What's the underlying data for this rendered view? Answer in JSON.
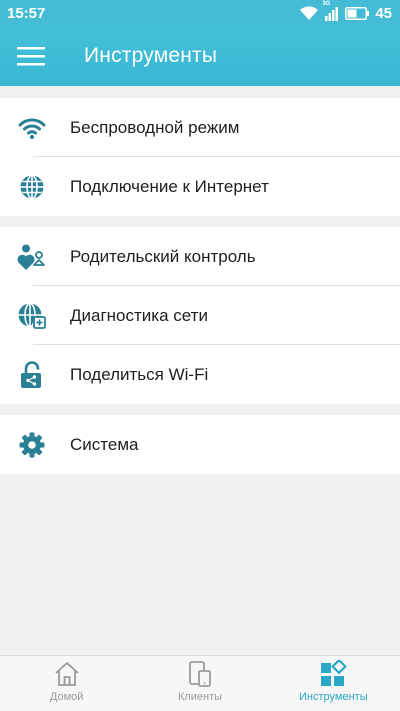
{
  "status_bar": {
    "time": "15:57",
    "network": "3G",
    "battery": "45",
    "icons": [
      "wifi-icon",
      "signal-icon",
      "battery-icon"
    ]
  },
  "app_bar": {
    "title": "Инструменты",
    "menu_icon": "hamburger-menu-icon"
  },
  "sections": [
    {
      "items": [
        {
          "label": "Беспроводной режим",
          "icon": "wifi-icon"
        },
        {
          "label": "Подключение к Интернет",
          "icon": "globe-icon"
        }
      ]
    },
    {
      "items": [
        {
          "label": "Родительский контроль",
          "icon": "parental-control-icon"
        },
        {
          "label": "Диагностика сети",
          "icon": "network-diagnostics-icon"
        },
        {
          "label": "Поделиться Wi-Fi",
          "icon": "share-wifi-lock-icon"
        }
      ]
    },
    {
      "items": [
        {
          "label": "Система",
          "icon": "gear-icon"
        }
      ]
    }
  ],
  "tab_bar": {
    "tabs": [
      {
        "label": "Домой",
        "icon": "home-icon",
        "active": false
      },
      {
        "label": "Клиенты",
        "icon": "devices-icon",
        "active": false
      },
      {
        "label": "Инструменты",
        "icon": "tools-grid-icon",
        "active": true
      }
    ]
  },
  "colors": {
    "accent": "#3ab8d4",
    "icon_teal": "#2a7f95",
    "background": "#f1f1f1"
  }
}
